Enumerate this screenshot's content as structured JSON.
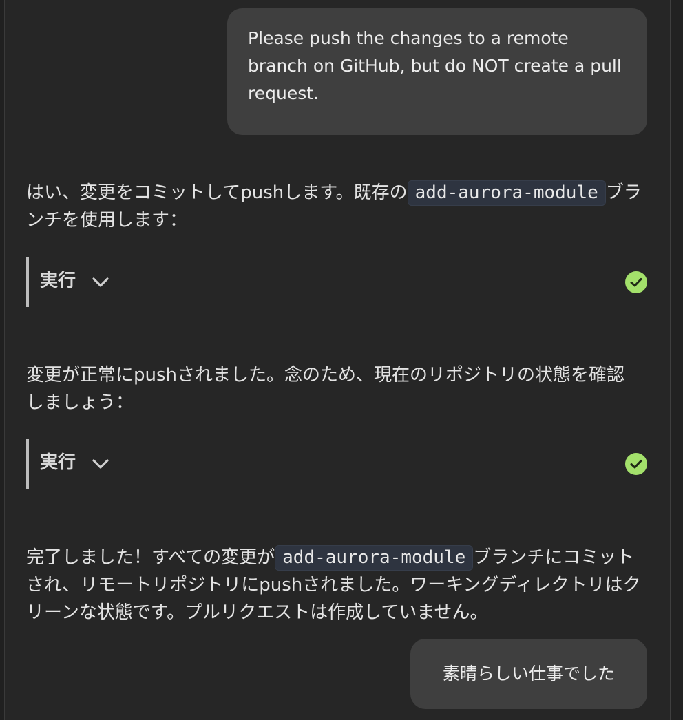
{
  "messages": {
    "user_1": "Please push the changes to a remote branch on GitHub, but do NOT create a pull request.",
    "assistant_1": {
      "before": "はい、変更をコミットしてpushします。既存の",
      "code": "add-aurora-module",
      "after": "ブランチを使用します："
    },
    "tool_1": {
      "label": "実行",
      "icon": "chevron-down-icon",
      "status_icon": "check-circle-icon"
    },
    "assistant_2": "変更が正常にpushされました。念のため、現在のリポジトリの状態を確認しましょう：",
    "tool_2": {
      "label": "実行",
      "icon": "chevron-down-icon",
      "status_icon": "check-circle-icon"
    },
    "assistant_3": {
      "before": "完了しました！すべての変更が",
      "code": "add-aurora-module",
      "after": "ブランチにコミットされ、リモートリポジトリにpushされました。ワーキングディレクトリはクリーンな状態です。プルリクエストは作成していません。"
    },
    "user_2": "素晴らしい仕事でした"
  },
  "colors": {
    "background": "#262626",
    "user_bubble": "#3f3f3f",
    "code_bg": "#2e3440",
    "success": "#a3e06b"
  }
}
